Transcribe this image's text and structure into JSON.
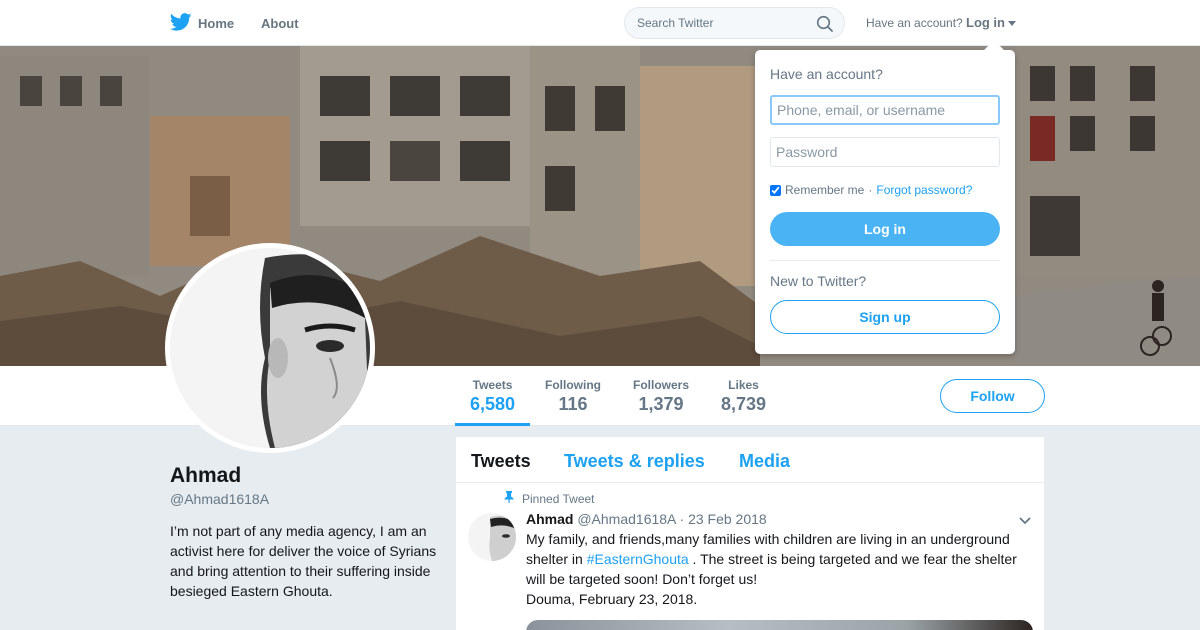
{
  "nav": {
    "home_label": "Home",
    "about_label": "About",
    "search_placeholder": "Search Twitter",
    "have_account": "Have an account?",
    "login_label": "Log in",
    "icons": [
      "twitter-bird-icon",
      "search-icon",
      "caret-down-icon"
    ],
    "accent_color": "#1da1f2"
  },
  "stats": [
    {
      "label": "Tweets",
      "value": "6,580",
      "active": true
    },
    {
      "label": "Following",
      "value": "116"
    },
    {
      "label": "Followers",
      "value": "1,379"
    },
    {
      "label": "Likes",
      "value": "8,739"
    }
  ],
  "follow_label": "Follow",
  "profile": {
    "name": "Ahmad",
    "handle": "@Ahmad1618A",
    "bio": "I’m not part of any media agency, I am an activist here for deliver the voice of Syrians and bring attention to their suffering inside besieged Eastern Ghouta."
  },
  "timeline": {
    "tabs": [
      "Tweets",
      "Tweets & replies",
      "Media"
    ],
    "active_tab": "Tweets",
    "tweet": {
      "pinned_label": "Pinned Tweet",
      "name": "Ahmad",
      "handle": "@Ahmad1618A",
      "sep": "·",
      "date": "23 Feb 2018",
      "text_before": "My family,  and friends,many families with children are living in an underground shelter in ",
      "hashtag": "#EasternGhouta",
      "text_after": " . The street is being targeted and we fear the shelter will be targeted soon! Don’t forget us!",
      "location_line": "Douma, February 23, 2018."
    }
  },
  "login_dropdown": {
    "title": "Have an account?",
    "username_placeholder": "Phone, email, or username",
    "password_placeholder": "Password",
    "remember_label": "Remember me",
    "dot": "·",
    "forgot_label": "Forgot password?",
    "remember_checked": true,
    "login_button": "Log in",
    "new_prompt": "New to Twitter?",
    "signup_button": "Sign up"
  }
}
